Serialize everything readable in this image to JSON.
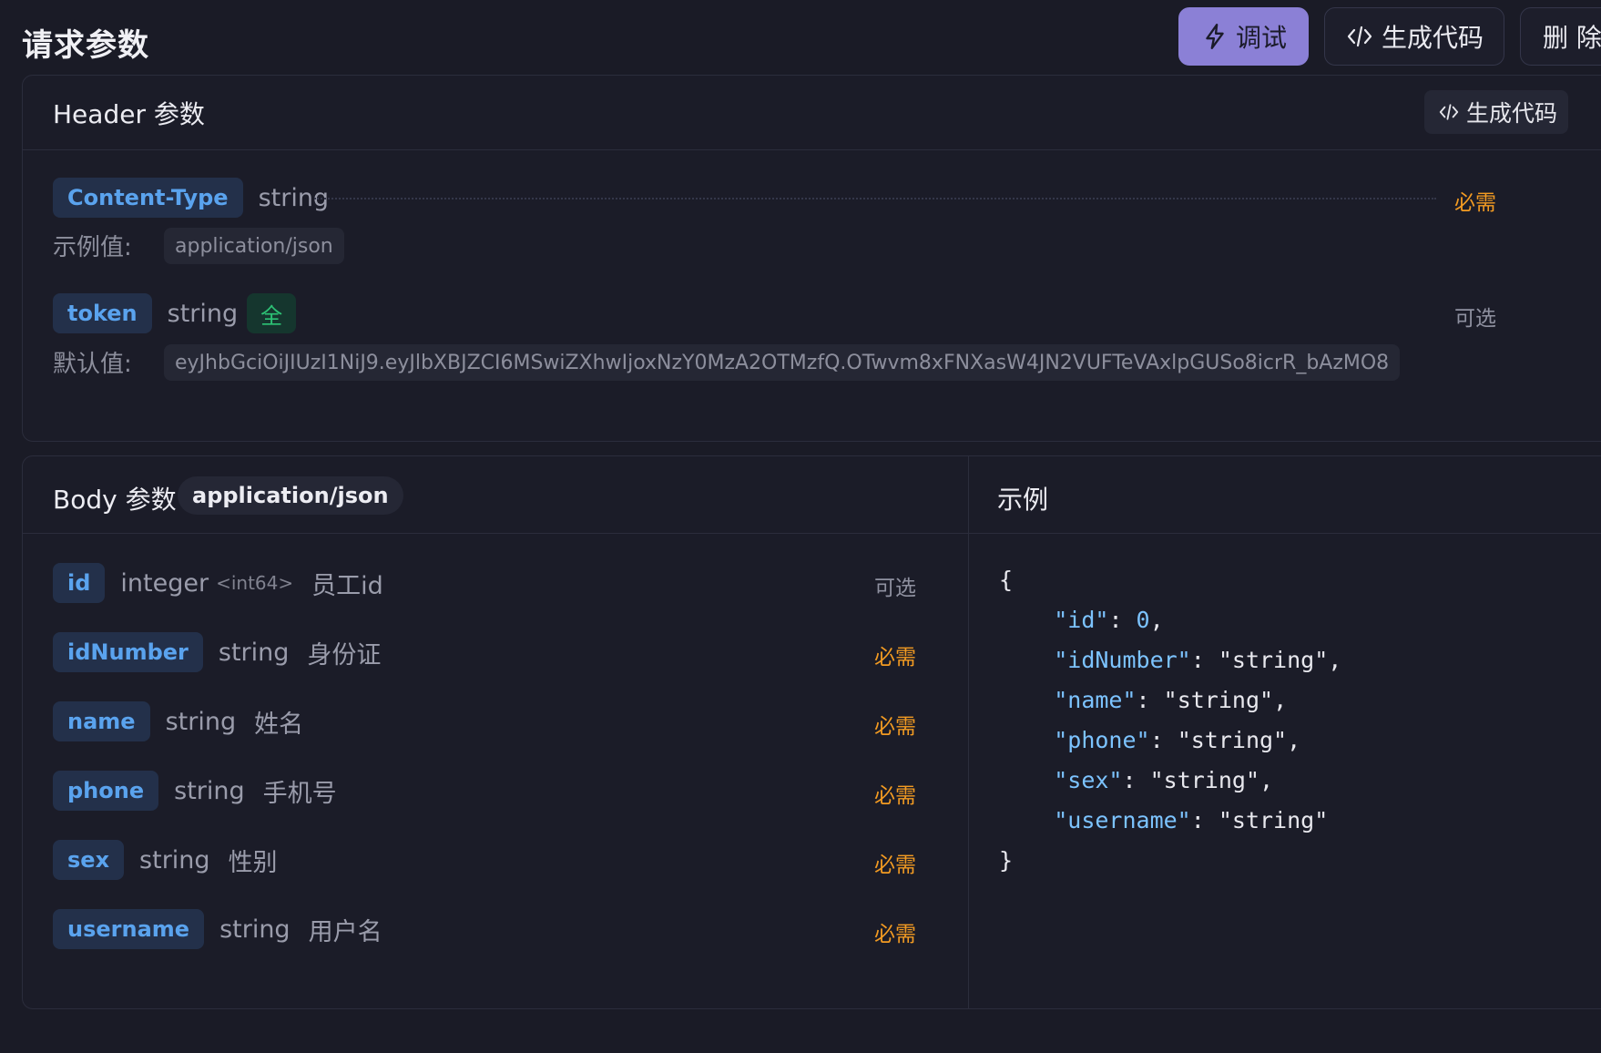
{
  "page": {
    "title": "请求参数"
  },
  "toolbar": {
    "debug_label": "调试",
    "generate_label": "生成代码",
    "delete_label": "删 除"
  },
  "header_section": {
    "title": "Header 参数",
    "generate_label": "生成代码",
    "params": [
      {
        "name": "Content-Type",
        "type": "string",
        "status": "必需",
        "value_label": "示例值:",
        "value": "application/json"
      },
      {
        "name": "token",
        "type": "string",
        "badge": "全",
        "status": "可选",
        "value_label": "默认值:",
        "value": "eyJhbGciOiJIUzI1NiJ9.eyJlbXBJZCI6MSwiZXhwIjoxNzY0MzA2OTMzfQ.OTwvm8xFNXasW4JN2VUFTeVAxlpGUSo8icrR_bAzMO8"
      }
    ]
  },
  "body_section": {
    "title": "Body 参数",
    "content_type": "application/json",
    "params": [
      {
        "name": "id",
        "type": "integer",
        "format": "<int64>",
        "desc": "员工id",
        "status": "可选"
      },
      {
        "name": "idNumber",
        "type": "string",
        "desc": "身份证",
        "status": "必需"
      },
      {
        "name": "name",
        "type": "string",
        "desc": "姓名",
        "status": "必需"
      },
      {
        "name": "phone",
        "type": "string",
        "desc": "手机号",
        "status": "必需"
      },
      {
        "name": "sex",
        "type": "string",
        "desc": "性别",
        "status": "必需"
      },
      {
        "name": "username",
        "type": "string",
        "desc": "用户名",
        "status": "必需"
      }
    ]
  },
  "example_section": {
    "title": "示例",
    "open": "{",
    "close": "}",
    "lines": [
      {
        "key": "\"id\"",
        "sep": ": ",
        "value": "0",
        "comma": ","
      },
      {
        "key": "\"idNumber\"",
        "sep": ": ",
        "value": "\"string\"",
        "comma": ","
      },
      {
        "key": "\"name\"",
        "sep": ": ",
        "value": "\"string\"",
        "comma": ","
      },
      {
        "key": "\"phone\"",
        "sep": ": ",
        "value": "\"string\"",
        "comma": ","
      },
      {
        "key": "\"sex\"",
        "sep": ": ",
        "value": "\"string\"",
        "comma": ","
      },
      {
        "key": "\"username\"",
        "sep": ": ",
        "value": "\"string\"",
        "comma": ""
      }
    ]
  },
  "icons": {
    "debug": "lightning-icon",
    "generate": "code-icon"
  },
  "colors": {
    "accent": "#8b80d6",
    "required": "#f39b22",
    "tag_text": "#5aa3ee",
    "badge_green": "#2dc275"
  }
}
